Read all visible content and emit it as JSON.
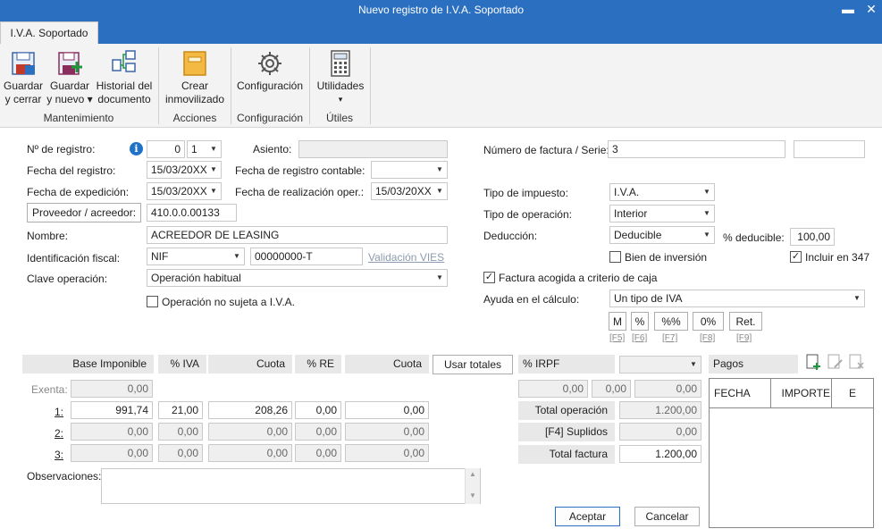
{
  "window": {
    "title": "Nuevo registro de I.V.A. Soportado",
    "minimize": "▬",
    "close": "✕"
  },
  "ribbon": {
    "tab": "I.V.A. Soportado",
    "buttons": {
      "guardar_cerrar": [
        "Guardar",
        "y cerrar"
      ],
      "guardar_nuevo": [
        "Guardar",
        "y nuevo ▾"
      ],
      "historial": [
        "Historial del",
        "documento"
      ],
      "crear_inmov": [
        "Crear",
        "inmovilizado"
      ],
      "configuracion": "Configuración",
      "utilidades": [
        "Utilidades",
        "▾"
      ]
    },
    "groups": {
      "mantenimiento": "Mantenimiento",
      "acciones": "Acciones",
      "configuracion": "Configuración",
      "utiles": "Útiles"
    }
  },
  "form": {
    "labels": {
      "n_registro": "Nº de registro:",
      "asiento": "Asiento:",
      "fecha_registro": "Fecha del registro:",
      "fecha_contable": "Fecha de registro contable:",
      "fecha_expedicion": "Fecha de expedición:",
      "fecha_realizacion": "Fecha de realización oper.:",
      "proveedor_btn": "Proveedor / acreedor:",
      "nombre": "Nombre:",
      "ident_fiscal": "Identificación fiscal:",
      "validacion_vies": "Validación VIES",
      "clave_operacion": "Clave operación:",
      "op_no_sujeta": "Operación no sujeta a I.V.A.",
      "num_factura": "Número de factura / Serie:",
      "tipo_impuesto": "Tipo de impuesto:",
      "tipo_operacion": "Tipo de operación:",
      "deduccion": "Deducción:",
      "pct_deducible": "% deducible:",
      "bien_inversion": "Bien de inversión",
      "incluir_347": "Incluir en 347",
      "criterio_caja": "Factura acogida a criterio de caja",
      "ayuda_calculo": "Ayuda en el cálculo:"
    },
    "values": {
      "n_registro": "0",
      "n_registro_serie": "1",
      "asiento": "",
      "fecha_registro": "15/03/20XX",
      "fecha_contable": "",
      "fecha_expedicion": "15/03/20XX",
      "fecha_realizacion": "15/03/20XX",
      "proveedor_cuenta": "410.0.0.00133",
      "nombre": "ACREEDOR  DE LEASING",
      "ident_tipo": "NIF",
      "ident_num": "00000000-T",
      "clave_operacion": "Operación habitual",
      "num_factura": "3",
      "serie": "",
      "tipo_impuesto": "I.V.A.",
      "tipo_operacion": "Interior",
      "deduccion": "Deducible",
      "pct_deducible": "100,00",
      "ayuda_calculo": "Un tipo de IVA"
    },
    "checks": {
      "op_no_sujeta": false,
      "bien_inversion": false,
      "incluir_347": true,
      "criterio_caja": true
    },
    "calc_buttons": [
      {
        "label": "M",
        "key": "[F5]"
      },
      {
        "label": "%",
        "key": "[F6]"
      },
      {
        "label": "%%",
        "key": "[F7]"
      },
      {
        "label": "0%",
        "key": "[F8]"
      },
      {
        "label": "Ret.",
        "key": "[F9]"
      }
    ]
  },
  "grid": {
    "headers": {
      "base": "Base Imponible",
      "iva": "% IVA",
      "cuota": "Cuota",
      "re": "% RE",
      "cuota_re": "Cuota",
      "usar_totales": "Usar totales",
      "irpf": "% IRPF",
      "pagos": "Pagos"
    },
    "exenta_label": "Exenta:",
    "exenta_value": "0,00",
    "rows": [
      {
        "label": "1:",
        "base": "991,74",
        "iva": "21,00",
        "cuota": "208,26",
        "re": "0,00",
        "cuota_re": "0,00"
      },
      {
        "label": "2:",
        "base": "0,00",
        "iva": "0,00",
        "cuota": "0,00",
        "re": "0,00",
        "cuota_re": "0,00"
      },
      {
        "label": "3:",
        "base": "0,00",
        "iva": "0,00",
        "cuota": "0,00",
        "re": "0,00",
        "cuota_re": "0,00"
      }
    ],
    "irpf_values": [
      "0,00",
      "0,00",
      "0,00"
    ],
    "totals": {
      "total_operacion_label": "Total operación",
      "total_operacion": "1.200,00",
      "suplidos_label": "[F4] Suplidos",
      "suplidos": "0,00",
      "total_factura_label": "Total factura",
      "total_factura": "1.200,00"
    },
    "pagos_cols": {
      "fecha": "FECHA",
      "importe": "IMPORTE",
      "e": "E"
    },
    "observaciones": "Observaciones:"
  },
  "footer": {
    "aceptar": "Aceptar",
    "cancelar": "Cancelar"
  }
}
